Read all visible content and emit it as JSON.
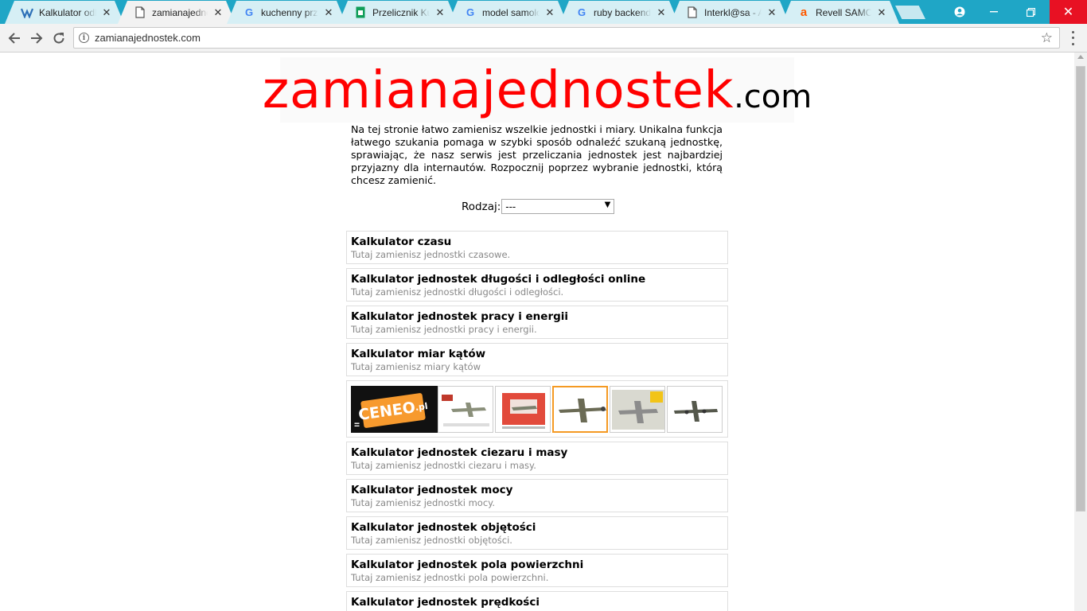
{
  "browser": {
    "tabs": [
      {
        "title": "Kalkulator odległości",
        "favicon": "page-icon",
        "active": false
      },
      {
        "title": "zamianajednostek.com",
        "favicon": "document-icon",
        "active": true
      },
      {
        "title": "kuchenny przelicznik",
        "favicon": "google-icon",
        "active": false
      },
      {
        "title": "Przelicznik Kuchenny",
        "favicon": "sheets-icon",
        "active": false
      },
      {
        "title": "model samolotu",
        "favicon": "google-icon",
        "active": false
      },
      {
        "title": "ruby backend",
        "favicon": "google-icon",
        "active": false
      },
      {
        "title": "Interkl@sa - Archiwum",
        "favicon": "document-icon",
        "active": false
      },
      {
        "title": "Revell SAMOLOT",
        "favicon": "allegro-icon",
        "active": false
      }
    ],
    "url": "zamianajednostek.com"
  },
  "page": {
    "logo_main": "zamianajednostek",
    "logo_suffix": ".com",
    "intro": "Na tej stronie łatwo zamienisz wszelkie jednostki i miary. Unikalna funkcja łatwego szukania pomaga w szybki sposób odnaleźć szukaną jednostkę, sprawiając, że nasz serwis jest przeliczania jednostek jest najbardziej przyjazny dla internautów. Rozpocznij poprzez wybranie jednostki, którą chcesz zamienić.",
    "kind_label": "Rodzaj:",
    "kind_value": "---",
    "calculators_top": [
      {
        "title": "Kalkulator czasu",
        "desc": "Tutaj zamienisz jednostki czasowe."
      },
      {
        "title": "Kalkulator jednostek długości i odległości online",
        "desc": "Tutaj zamienisz jednostki długości i odległości."
      },
      {
        "title": "Kalkulator jednostek pracy i energii",
        "desc": "Tutaj zamienisz jednostki pracy i energii."
      },
      {
        "title": "Kalkulator miar kątów",
        "desc": "Tutaj zamienisz miary kątów"
      }
    ],
    "ad": {
      "brand": "CENEO",
      "brand_suffix": ".pl",
      "thumb_count": 6
    },
    "calculators_bottom": [
      {
        "title": "Kalkulator jednostek ciezaru i masy",
        "desc": "Tutaj zamienisz jednostki ciezaru i masy."
      },
      {
        "title": "Kalkulator jednostek mocy",
        "desc": "Tutaj zamienisz jednostki mocy."
      },
      {
        "title": "Kalkulator jednostek objętości",
        "desc": "Tutaj zamienisz jednostki objętości."
      },
      {
        "title": "Kalkulator jednostek pola powierzchni",
        "desc": "Tutaj zamienisz jednostki pola powierzchni."
      },
      {
        "title": "Kalkulator jednostek prędkości",
        "desc": ""
      }
    ]
  }
}
